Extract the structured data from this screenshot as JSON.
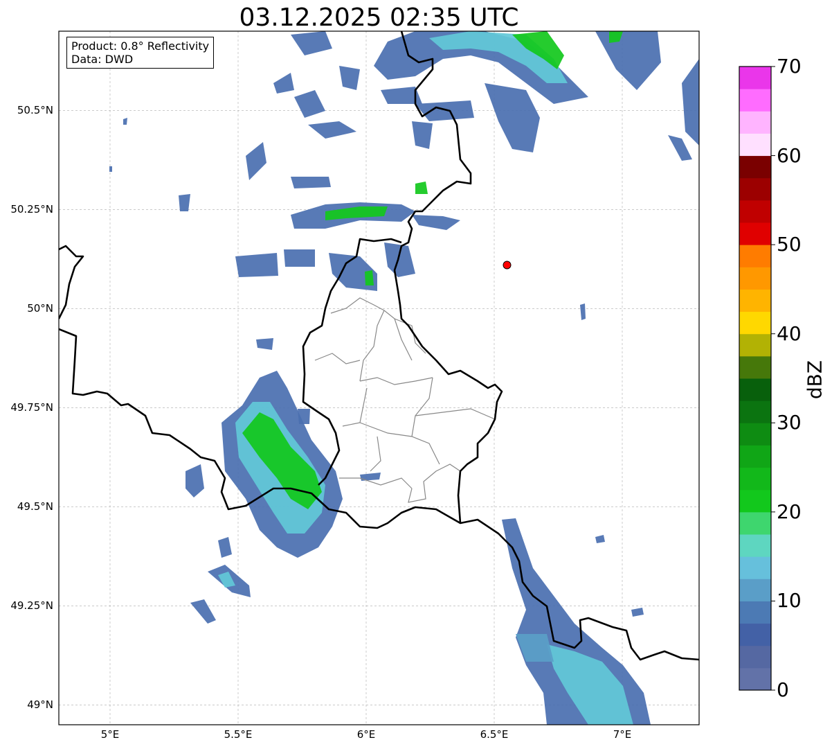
{
  "title": "03.12.2025 02:35 UTC",
  "info": {
    "product": "Product: 0.8° Reflectivity",
    "source": "Data: DWD"
  },
  "map": {
    "lon_range": [
      4.8,
      7.3
    ],
    "lat_range": [
      48.95,
      50.7
    ],
    "lat_ticks": [
      {
        "value": 50.5,
        "label": "50.5°N"
      },
      {
        "value": 50.25,
        "label": "50.25°N"
      },
      {
        "value": 50.0,
        "label": "50°N"
      },
      {
        "value": 49.75,
        "label": "49.75°N"
      },
      {
        "value": 49.5,
        "label": "49.5°N"
      },
      {
        "value": 49.25,
        "label": "49.25°N"
      },
      {
        "value": 49.0,
        "label": "49°N"
      }
    ],
    "lon_ticks": [
      {
        "value": 5.0,
        "label": "5°E"
      },
      {
        "value": 5.5,
        "label": "5.5°E"
      },
      {
        "value": 6.0,
        "label": "6°E"
      },
      {
        "value": 6.5,
        "label": "6.5°E"
      },
      {
        "value": 7.0,
        "label": "7°E"
      }
    ],
    "grid": true,
    "marker": {
      "lon": 6.55,
      "lat": 50.11,
      "color": "#ff0000"
    }
  },
  "colorbar": {
    "label": "dBZ",
    "min": 0,
    "max": 70,
    "ticks": [
      {
        "value": 0,
        "label": "0"
      },
      {
        "value": 10,
        "label": "10"
      },
      {
        "value": 20,
        "label": "20"
      },
      {
        "value": 30,
        "label": "30"
      },
      {
        "value": 40,
        "label": "40"
      },
      {
        "value": 50,
        "label": "50"
      },
      {
        "value": 60,
        "label": "60"
      },
      {
        "value": 70,
        "label": "70"
      }
    ],
    "colors": [
      "#6272a8",
      "#5568a2",
      "#4361a6",
      "#4c7ab4",
      "#5a9ec8",
      "#66c0dc",
      "#5ed6c0",
      "#3ed66e",
      "#12c81c",
      "#12b81a",
      "#10a616",
      "#0e8c12",
      "#0b7410",
      "#08600c",
      "#46780a",
      "#b2b204",
      "#ffd800",
      "#ffb400",
      "#ff9800",
      "#ff7c00",
      "#e00000",
      "#c00000",
      "#9c0000",
      "#7a0000",
      "#ffe0ff",
      "#ffb4ff",
      "#ff6cff",
      "#ea36ea"
    ]
  },
  "echo_colors": {
    "base": "#4a6fb0",
    "light": "#5a9ec8",
    "cyan": "#62c8d8",
    "green": "#12c81c",
    "dark": "#42589a"
  }
}
